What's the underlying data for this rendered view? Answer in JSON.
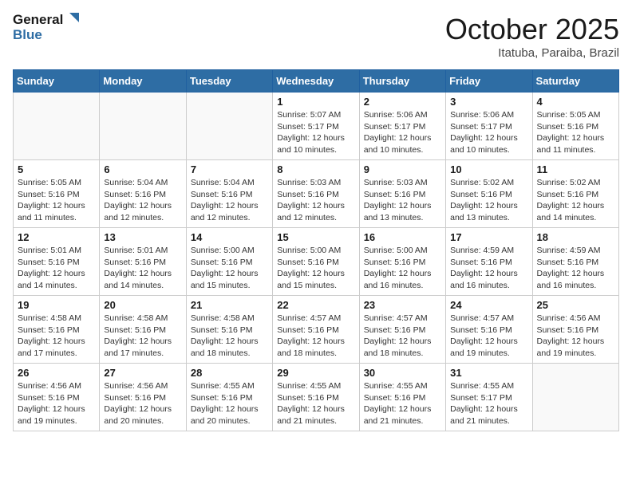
{
  "header": {
    "logo_general": "General",
    "logo_blue": "Blue",
    "month_title": "October 2025",
    "subtitle": "Itatuba, Paraiba, Brazil"
  },
  "days_of_week": [
    "Sunday",
    "Monday",
    "Tuesday",
    "Wednesday",
    "Thursday",
    "Friday",
    "Saturday"
  ],
  "weeks": [
    [
      {
        "day": "",
        "info": ""
      },
      {
        "day": "",
        "info": ""
      },
      {
        "day": "",
        "info": ""
      },
      {
        "day": "1",
        "info": "Sunrise: 5:07 AM\nSunset: 5:17 PM\nDaylight: 12 hours and 10 minutes."
      },
      {
        "day": "2",
        "info": "Sunrise: 5:06 AM\nSunset: 5:17 PM\nDaylight: 12 hours and 10 minutes."
      },
      {
        "day": "3",
        "info": "Sunrise: 5:06 AM\nSunset: 5:17 PM\nDaylight: 12 hours and 10 minutes."
      },
      {
        "day": "4",
        "info": "Sunrise: 5:05 AM\nSunset: 5:16 PM\nDaylight: 12 hours and 11 minutes."
      }
    ],
    [
      {
        "day": "5",
        "info": "Sunrise: 5:05 AM\nSunset: 5:16 PM\nDaylight: 12 hours and 11 minutes."
      },
      {
        "day": "6",
        "info": "Sunrise: 5:04 AM\nSunset: 5:16 PM\nDaylight: 12 hours and 12 minutes."
      },
      {
        "day": "7",
        "info": "Sunrise: 5:04 AM\nSunset: 5:16 PM\nDaylight: 12 hours and 12 minutes."
      },
      {
        "day": "8",
        "info": "Sunrise: 5:03 AM\nSunset: 5:16 PM\nDaylight: 12 hours and 12 minutes."
      },
      {
        "day": "9",
        "info": "Sunrise: 5:03 AM\nSunset: 5:16 PM\nDaylight: 12 hours and 13 minutes."
      },
      {
        "day": "10",
        "info": "Sunrise: 5:02 AM\nSunset: 5:16 PM\nDaylight: 12 hours and 13 minutes."
      },
      {
        "day": "11",
        "info": "Sunrise: 5:02 AM\nSunset: 5:16 PM\nDaylight: 12 hours and 14 minutes."
      }
    ],
    [
      {
        "day": "12",
        "info": "Sunrise: 5:01 AM\nSunset: 5:16 PM\nDaylight: 12 hours and 14 minutes."
      },
      {
        "day": "13",
        "info": "Sunrise: 5:01 AM\nSunset: 5:16 PM\nDaylight: 12 hours and 14 minutes."
      },
      {
        "day": "14",
        "info": "Sunrise: 5:00 AM\nSunset: 5:16 PM\nDaylight: 12 hours and 15 minutes."
      },
      {
        "day": "15",
        "info": "Sunrise: 5:00 AM\nSunset: 5:16 PM\nDaylight: 12 hours and 15 minutes."
      },
      {
        "day": "16",
        "info": "Sunrise: 5:00 AM\nSunset: 5:16 PM\nDaylight: 12 hours and 16 minutes."
      },
      {
        "day": "17",
        "info": "Sunrise: 4:59 AM\nSunset: 5:16 PM\nDaylight: 12 hours and 16 minutes."
      },
      {
        "day": "18",
        "info": "Sunrise: 4:59 AM\nSunset: 5:16 PM\nDaylight: 12 hours and 16 minutes."
      }
    ],
    [
      {
        "day": "19",
        "info": "Sunrise: 4:58 AM\nSunset: 5:16 PM\nDaylight: 12 hours and 17 minutes."
      },
      {
        "day": "20",
        "info": "Sunrise: 4:58 AM\nSunset: 5:16 PM\nDaylight: 12 hours and 17 minutes."
      },
      {
        "day": "21",
        "info": "Sunrise: 4:58 AM\nSunset: 5:16 PM\nDaylight: 12 hours and 18 minutes."
      },
      {
        "day": "22",
        "info": "Sunrise: 4:57 AM\nSunset: 5:16 PM\nDaylight: 12 hours and 18 minutes."
      },
      {
        "day": "23",
        "info": "Sunrise: 4:57 AM\nSunset: 5:16 PM\nDaylight: 12 hours and 18 minutes."
      },
      {
        "day": "24",
        "info": "Sunrise: 4:57 AM\nSunset: 5:16 PM\nDaylight: 12 hours and 19 minutes."
      },
      {
        "day": "25",
        "info": "Sunrise: 4:56 AM\nSunset: 5:16 PM\nDaylight: 12 hours and 19 minutes."
      }
    ],
    [
      {
        "day": "26",
        "info": "Sunrise: 4:56 AM\nSunset: 5:16 PM\nDaylight: 12 hours and 19 minutes."
      },
      {
        "day": "27",
        "info": "Sunrise: 4:56 AM\nSunset: 5:16 PM\nDaylight: 12 hours and 20 minutes."
      },
      {
        "day": "28",
        "info": "Sunrise: 4:55 AM\nSunset: 5:16 PM\nDaylight: 12 hours and 20 minutes."
      },
      {
        "day": "29",
        "info": "Sunrise: 4:55 AM\nSunset: 5:16 PM\nDaylight: 12 hours and 21 minutes."
      },
      {
        "day": "30",
        "info": "Sunrise: 4:55 AM\nSunset: 5:16 PM\nDaylight: 12 hours and 21 minutes."
      },
      {
        "day": "31",
        "info": "Sunrise: 4:55 AM\nSunset: 5:17 PM\nDaylight: 12 hours and 21 minutes."
      },
      {
        "day": "",
        "info": ""
      }
    ]
  ]
}
